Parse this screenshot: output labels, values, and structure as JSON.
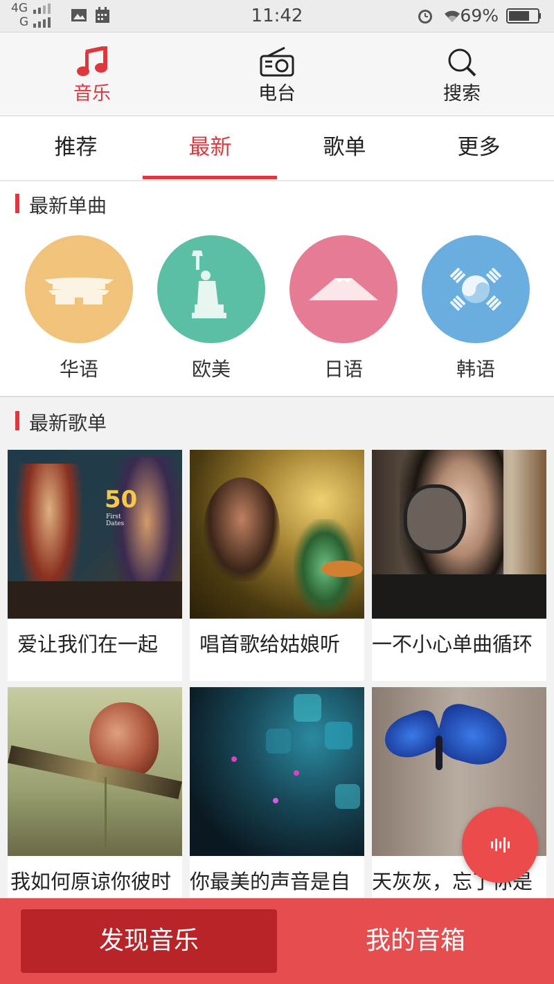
{
  "status_bar": {
    "network_top": "4G",
    "network_bottom": "G",
    "time": "11:42",
    "battery": "69%",
    "icons": [
      "gallery-icon",
      "calendar-icon",
      "alarm-icon",
      "wifi-icon",
      "battery-icon"
    ]
  },
  "top_nav": {
    "items": [
      {
        "label": "音乐",
        "icon": "music-note-icon",
        "active": true
      },
      {
        "label": "电台",
        "icon": "radio-icon",
        "active": false
      },
      {
        "label": "搜索",
        "icon": "search-icon",
        "active": false
      }
    ]
  },
  "sub_tabs": {
    "items": [
      {
        "label": "推荐",
        "active": false
      },
      {
        "label": "最新",
        "active": true
      },
      {
        "label": "歌单",
        "active": false
      },
      {
        "label": "更多",
        "active": false
      }
    ]
  },
  "new_singles": {
    "title": "最新单曲",
    "categories": [
      {
        "label": "华语",
        "icon": "palace-icon",
        "color": "#f0c27a"
      },
      {
        "label": "欧美",
        "icon": "statue-of-liberty-icon",
        "color": "#5bbfa6"
      },
      {
        "label": "日语",
        "icon": "mount-fuji-icon",
        "color": "#e57c93"
      },
      {
        "label": "韩语",
        "icon": "korean-flag-icon",
        "color": "#6aaee0"
      }
    ]
  },
  "new_playlists": {
    "title": "最新歌单",
    "items": [
      {
        "title": "爱让我们在一起"
      },
      {
        "title": "唱首歌给姑娘听"
      },
      {
        "title": "一不小心单曲循环"
      },
      {
        "title": "我如何原谅你彼时"
      },
      {
        "title": "你最美的声音是自"
      },
      {
        "title": "天灰灰，忘了你是"
      }
    ],
    "art_text": {
      "number": "50",
      "small": "First Dates"
    }
  },
  "float_button": {
    "icon": "soundwave-icon"
  },
  "bottom_bar": {
    "tabs": [
      {
        "label": "发现音乐",
        "active": true
      },
      {
        "label": "我的音箱",
        "active": false
      }
    ]
  },
  "colors": {
    "accent": "#e0373d",
    "bottom_bar": "#e64d4f",
    "bottom_active": "#b82428"
  }
}
